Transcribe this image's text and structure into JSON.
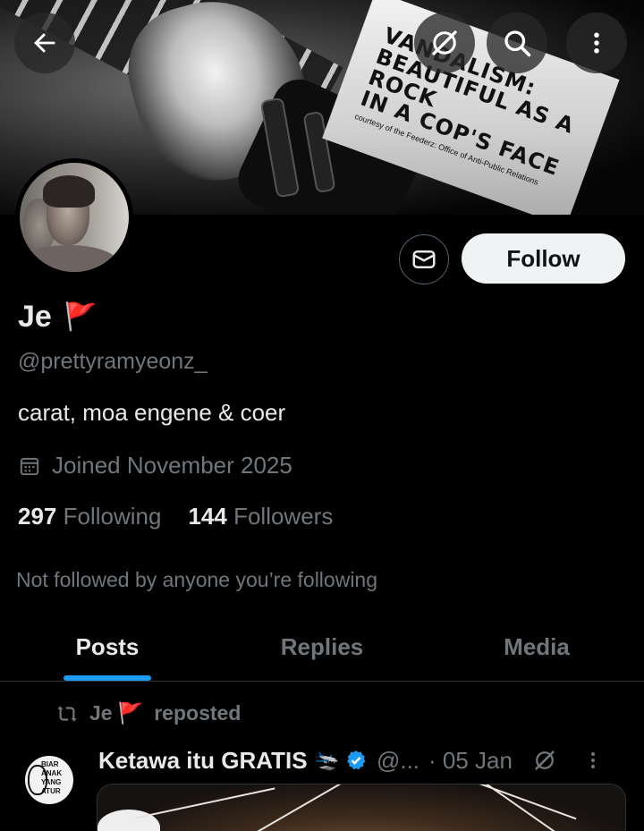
{
  "banner": {
    "sticker_lines": [
      "VANDALISM:",
      "BEAUTIFUL AS A ROCK",
      "IN A COP'S FACE"
    ],
    "sticker_credit": "courtesy of the Feederz: Office of Anti-Public Relations"
  },
  "toolbar": {
    "back_icon": "arrow-left-icon",
    "grok_icon": "grok-icon",
    "search_icon": "search-icon",
    "more_icon": "more-vertical-icon"
  },
  "profile": {
    "name": "Je",
    "name_emoji": "🚩",
    "handle": "@prettyramyeonz_",
    "bio": "carat, moa engene & coer",
    "joined": "Joined November 2025",
    "following_count": "297",
    "following_label": "Following",
    "followers_count": "144",
    "followers_label": "Followers",
    "not_followed": "Not followed by anyone you’re following",
    "follow_label": "Follow"
  },
  "tabs": [
    {
      "label": "Posts",
      "active": true
    },
    {
      "label": "Replies",
      "active": false
    },
    {
      "label": "Media",
      "active": false
    }
  ],
  "post": {
    "repost_name": "Je",
    "repost_emoji": "🚩",
    "repost_label": "reposted",
    "author": "Ketawa itu GRATIS",
    "author_emoji": "🛬",
    "handle_truncated": "@...",
    "date": "· 05 Jan",
    "avatar_text": "BIAR ANAK YANG ATUR"
  },
  "colors": {
    "accent": "#1d9bf0",
    "muted": "#71767b",
    "background": "#000000",
    "verified": "#1d9bf0"
  }
}
